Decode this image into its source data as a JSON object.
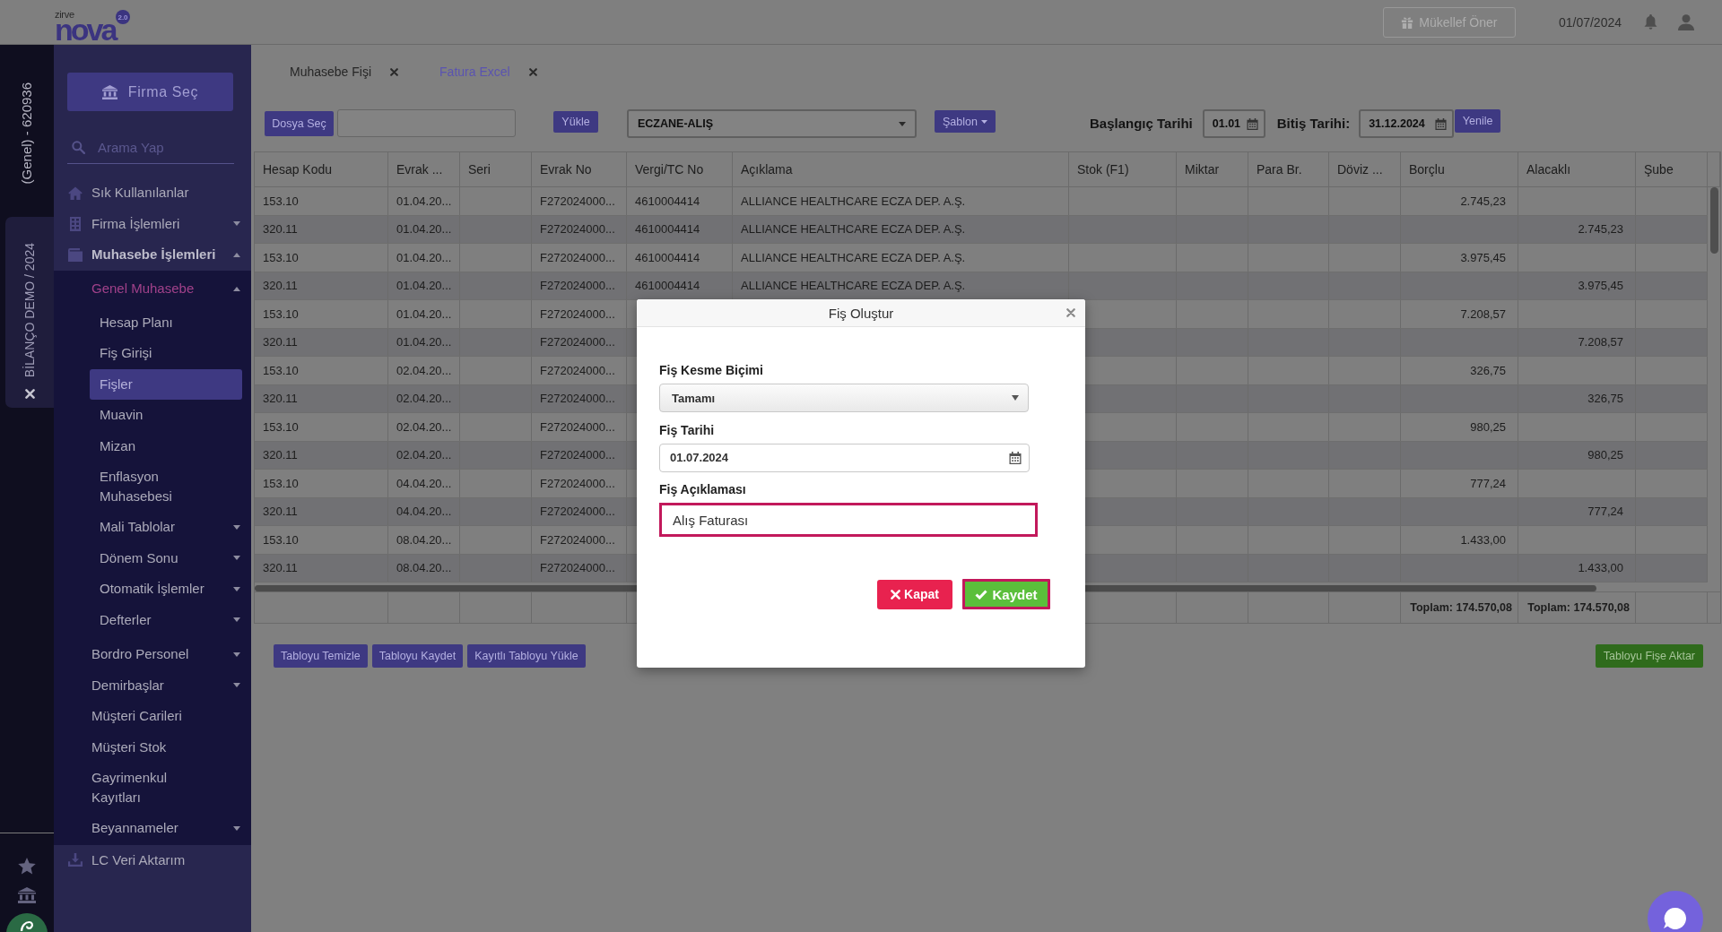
{
  "top_bar": {
    "logo": {
      "caption": "zirve",
      "wordmark": "nova",
      "badge": "2.0"
    },
    "suggest_button": "Mükellef Öner",
    "date": "01/07/2024"
  },
  "side_strip": {
    "account": "(Genel) - 620936",
    "company": "BİLANÇO DEMO / 2024"
  },
  "sidebar": {
    "company_button": "Firma Seç",
    "search": {
      "placeholder": "Arama Yap"
    },
    "items": [
      {
        "label": "Sık Kullanılanlar",
        "selected": false
      },
      {
        "label": "Firma İşlemleri",
        "expanded": false,
        "selected": false
      },
      {
        "label": "Muhasebe İşlemleri",
        "expanded": true,
        "selected": false,
        "children": [
          {
            "label": "Genel Muhasebe",
            "expanded": true,
            "selected": false,
            "children": [
              {
                "label": "Hesap Planı",
                "selected": false
              },
              {
                "label": "Fiş Girişi",
                "selected": false
              },
              {
                "label": "Fişler",
                "selected": true
              },
              {
                "label": "Muavin",
                "selected": false
              },
              {
                "label": "Mizan",
                "selected": false
              },
              {
                "label": "Enflasyon Muhasebesi",
                "selected": false
              },
              {
                "label": "Mali Tablolar",
                "expanded": false,
                "selected": false
              },
              {
                "label": "Dönem Sonu",
                "expanded": false,
                "selected": false
              },
              {
                "label": "Otomatik İşlemler",
                "expanded": false,
                "selected": false
              },
              {
                "label": "Defterler",
                "expanded": false,
                "selected": false
              }
            ]
          },
          {
            "label": "Bordro Personel",
            "expanded": false,
            "selected": false
          },
          {
            "label": "Demirbaşlar",
            "expanded": false,
            "selected": false
          },
          {
            "label": "Müşteri Carileri",
            "selected": false
          },
          {
            "label": "Müşteri Stok",
            "selected": false
          },
          {
            "label": "Gayrimenkul Kayıtları",
            "selected": false
          },
          {
            "label": "Beyannameler",
            "expanded": false,
            "selected": false
          }
        ]
      },
      {
        "label": "LC Veri Aktarım",
        "selected": false
      }
    ]
  },
  "tabs": [
    {
      "label": "Muhasebe Fişi",
      "selected": false
    },
    {
      "label": "Fatura Excel",
      "selected": true
    }
  ],
  "toolbar": {
    "file_button": "Dosya Seç",
    "load_button": "Yükle",
    "template_select": {
      "value": "ECZANE-ALIŞ"
    },
    "template_button": "Şablon",
    "start_date": {
      "label": "Başlangıç Tarihi",
      "value": "01.01"
    },
    "end_date": {
      "label": "Bitiş Tarihi:",
      "value": "31.12.2024"
    },
    "refresh_button": "Yenile"
  },
  "table": {
    "columns": [
      "Hesap Kodu",
      "Evrak ...",
      "Seri",
      "Evrak No",
      "Vergi/TC No",
      "Açıklama",
      "Stok (F1)",
      "Miktar",
      "Para Br.",
      "Döviz ...",
      "Borçlu",
      "Alacaklı",
      "Şube"
    ],
    "rows": [
      {
        "hesap_kodu": "153.10",
        "evrak": "01.04.20...",
        "evrak_no": "F272024000...",
        "vergi_tc_no": "4610004414",
        "aciklama": "ALLIANCE HEALTHCARE ECZA DEP. A.Ş.",
        "borclu": "2.745,23"
      },
      {
        "hesap_kodu": "320.11",
        "evrak": "01.04.20...",
        "evrak_no": "F272024000...",
        "vergi_tc_no": "4610004414",
        "aciklama": "ALLIANCE HEALTHCARE ECZA DEP. A.Ş.",
        "alacakli": "2.745,23"
      },
      {
        "hesap_kodu": "153.10",
        "evrak": "01.04.20...",
        "evrak_no": "F272024000...",
        "vergi_tc_no": "4610004414",
        "aciklama": "ALLIANCE HEALTHCARE ECZA DEP. A.Ş.",
        "borclu": "3.975,45"
      },
      {
        "hesap_kodu": "320.11",
        "evrak": "01.04.20...",
        "evrak_no": "F272024000...",
        "vergi_tc_no": "4610004414",
        "aciklama": "ALLIANCE HEALTHCARE ECZA DEP. A.Ş.",
        "alacakli": "3.975,45"
      },
      {
        "hesap_kodu": "153.10",
        "evrak": "01.04.20...",
        "evrak_no": "F272024000...",
        "borclu": "7.208,57"
      },
      {
        "hesap_kodu": "320.11",
        "evrak": "01.04.20...",
        "evrak_no": "F272024000...",
        "alacakli": "7.208,57"
      },
      {
        "hesap_kodu": "153.10",
        "evrak": "02.04.20...",
        "evrak_no": "F272024000...",
        "borclu": "326,75"
      },
      {
        "hesap_kodu": "320.11",
        "evrak": "02.04.20...",
        "evrak_no": "F272024000...",
        "alacakli": "326,75"
      },
      {
        "hesap_kodu": "153.10",
        "evrak": "02.04.20...",
        "evrak_no": "F272024000...",
        "borclu": "980,25"
      },
      {
        "hesap_kodu": "320.11",
        "evrak": "02.04.20...",
        "evrak_no": "F272024000...",
        "alacakli": "980,25"
      },
      {
        "hesap_kodu": "153.10",
        "evrak": "04.04.20...",
        "evrak_no": "F272024000...",
        "borclu": "777,24"
      },
      {
        "hesap_kodu": "320.11",
        "evrak": "04.04.20...",
        "evrak_no": "F272024000...",
        "alacakli": "777,24"
      },
      {
        "hesap_kodu": "153.10",
        "evrak": "08.04.20...",
        "evrak_no": "F272024000...",
        "borclu": "1.433,00"
      },
      {
        "hesap_kodu": "320.11",
        "evrak": "08.04.20...",
        "evrak_no": "F272024000...",
        "alacakli": "1.433,00"
      }
    ],
    "totals": {
      "borclu": "Toplam: 174.570,08",
      "alacakli": "Toplam: 174.570,08"
    }
  },
  "table_actions": [
    "Tabloyu Temizle",
    "Tabloyu Kaydet",
    "Kayıtlı Tabloyu Yükle"
  ],
  "transfer_button": "Tabloyu Fişe Aktar",
  "dialog": {
    "title": "Fiş Oluştur",
    "fields": [
      {
        "kind": "select",
        "label": "Fiş Kesme Biçimi",
        "value": "Tamamı",
        "focused": false
      },
      {
        "kind": "date",
        "label": "Fiş Tarihi",
        "value": "01.07.2024",
        "focused": false
      },
      {
        "kind": "text",
        "label": "Fiş Açıklaması",
        "value": "Alış Faturası",
        "focused": true
      }
    ],
    "buttons": [
      {
        "kind": "cancel",
        "label": "Kapat",
        "focused": false
      },
      {
        "kind": "save",
        "label": "Kaydet",
        "focused": true
      }
    ]
  }
}
